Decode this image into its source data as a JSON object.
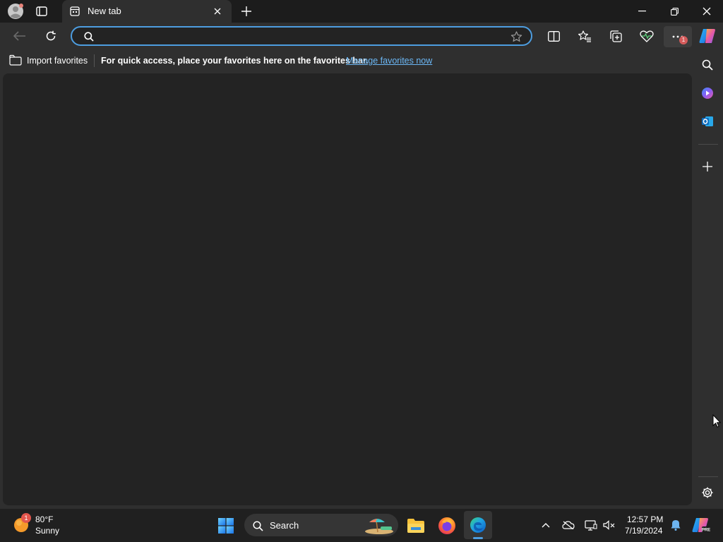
{
  "browser": {
    "tab": {
      "title": "New tab"
    },
    "address_bar": {
      "value": "",
      "placeholder": ""
    },
    "favorites_bar": {
      "import_label": "Import favorites",
      "message": "For quick access, place your favorites here on the favorites bar.",
      "manage_link": "Manage favorites now"
    },
    "toolbar": {
      "icons": [
        "back-icon",
        "refresh-icon",
        "search-icon",
        "favorite-star-icon",
        "split-screen-icon",
        "favorites-icon",
        "collections-icon",
        "browser-essentials-icon",
        "more-icon",
        "copilot-icon"
      ],
      "notification_badge": "1"
    },
    "sidebar": {
      "icons": [
        "search-icon",
        "copilot-icon",
        "outlook-icon",
        "add-icon",
        "settings-icon"
      ]
    }
  },
  "taskbar": {
    "weather": {
      "temperature": "80°F",
      "condition": "Sunny",
      "badge": "1"
    },
    "search_label": "Search",
    "clock": {
      "time": "12:57 PM",
      "date": "7/19/2024"
    },
    "pinned_apps": [
      "start-icon",
      "file-explorer-icon",
      "firefox-icon",
      "edge-icon"
    ],
    "tray_icons": [
      "chevron-up-icon",
      "onedrive-icon",
      "display-icon",
      "speaker-muted-icon",
      "notification-bell-icon",
      "copilot-pre-icon"
    ]
  },
  "colors": {
    "accent": "#4d9de0",
    "link": "#6bb7f5",
    "page_background": "#232323",
    "chrome_background": "#2f2f2f"
  }
}
